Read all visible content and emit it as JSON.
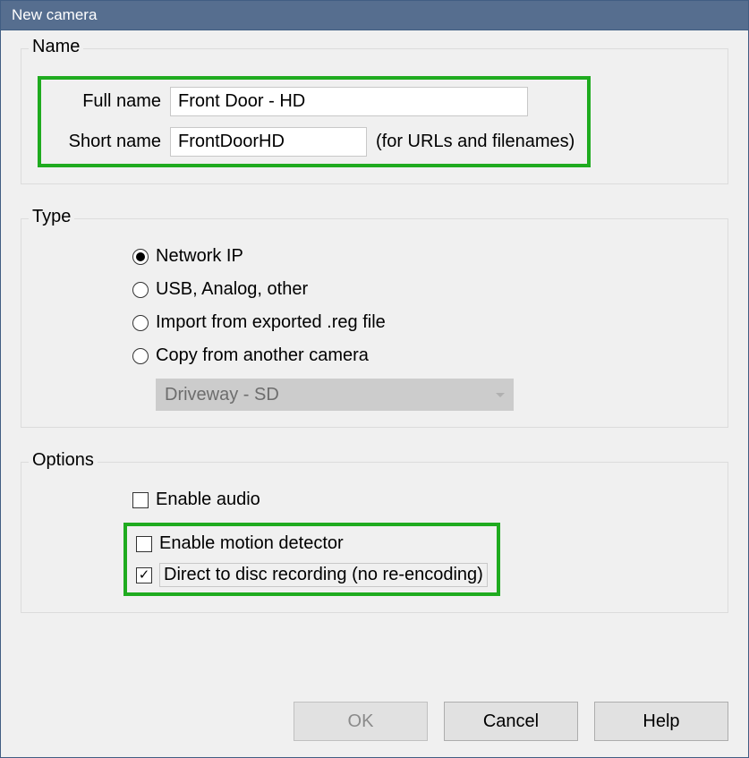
{
  "window": {
    "title": "New camera"
  },
  "groups": {
    "name": {
      "legend": "Name",
      "fullname_label": "Full name",
      "fullname_value": "Front Door - HD",
      "shortname_label": "Short name",
      "shortname_value": "FrontDoorHD",
      "shortname_hint": "(for URLs and filenames)"
    },
    "type": {
      "legend": "Type",
      "options": {
        "network": "Network IP",
        "usb": "USB, Analog, other",
        "import": "Import from exported .reg file",
        "copy": "Copy from another camera"
      },
      "copy_source": "Driveway - SD"
    },
    "options": {
      "legend": "Options",
      "audio": "Enable audio",
      "motion": "Enable motion detector",
      "direct": "Direct to disc recording (no re-encoding)"
    }
  },
  "buttons": {
    "ok": "OK",
    "cancel": "Cancel",
    "help": "Help"
  }
}
